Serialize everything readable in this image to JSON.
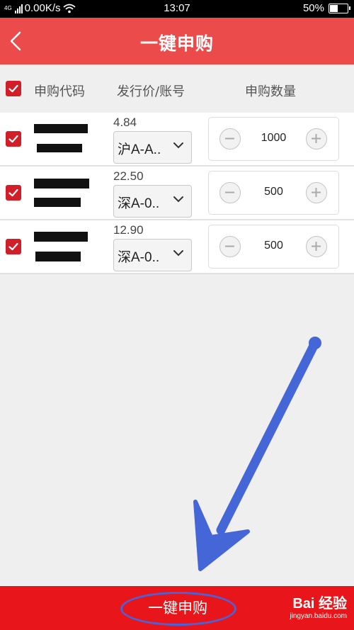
{
  "status_bar": {
    "network": "4G",
    "speed": "0.00K/s",
    "time": "13:07",
    "battery": "50%",
    "battery_level": 0.5
  },
  "header": {
    "title": "一键申购"
  },
  "columns": {
    "code": "申购代码",
    "price_account": "发行价/账号",
    "quantity": "申购数量"
  },
  "rows": [
    {
      "price": "4.84",
      "account": "沪A-A..",
      "quantity": "1000",
      "checked": true
    },
    {
      "price": "22.50",
      "account": "深A-0..",
      "quantity": "500",
      "checked": true
    },
    {
      "price": "12.90",
      "account": "深A-0..",
      "quantity": "500",
      "checked": true
    }
  ],
  "bottom": {
    "submit_label": "一键申购"
  },
  "watermark": {
    "brand": "Bai 经验",
    "url": "jingyan.baidu.com"
  },
  "colors": {
    "header": "#ec4b4b",
    "checkbox": "#d01f28",
    "bottom_bar": "#e8151a",
    "annotation": "#4a63d8"
  },
  "icons": {
    "back": "chevron-left-icon",
    "dropdown": "chevron-down-icon",
    "minus": "minus-icon",
    "plus": "plus-icon",
    "check": "check-icon"
  }
}
